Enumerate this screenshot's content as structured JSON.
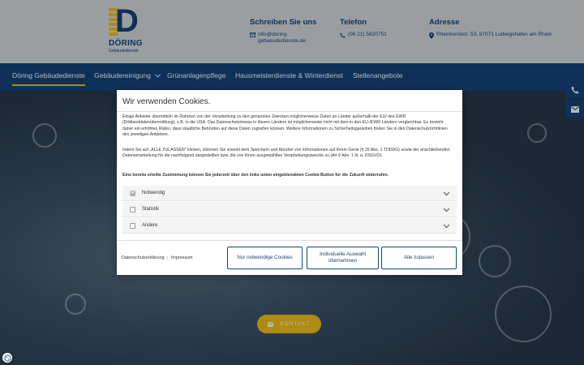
{
  "brand": {
    "name": "DÖRING",
    "tagline": "Gebäudedienste",
    "logo_letter": "D",
    "primary_color": "#15437c",
    "accent_color": "#f2c21b"
  },
  "contact": {
    "write": {
      "heading": "Schreiben Sie uns",
      "value": "info@doring-gebaeudedienste.de",
      "icon": "envelope-icon"
    },
    "phone": {
      "heading": "Telefon",
      "value": "(06 21) 5820751",
      "icon": "phone-icon"
    },
    "address": {
      "heading": "Adresse",
      "value": "Rheinhorststr. 53, 67071 Ludwigshafen am Rhein",
      "icon": "location-pin-icon"
    }
  },
  "nav": {
    "items": [
      {
        "label": "Döring Gebäudedienste",
        "active": true
      },
      {
        "label": "Gebäudereinigung",
        "has_dropdown": true
      },
      {
        "label": "Grünanlagenpflege"
      },
      {
        "label": "Hausmeisterdienste & Winterdienst"
      },
      {
        "label": "Stellenangebote"
      }
    ]
  },
  "hero": {
    "cta_label": "KONTAKT",
    "cta_icon": "envelope-icon"
  },
  "side_buttons": [
    "phone-icon",
    "envelope-icon"
  ],
  "cookie": {
    "title": "Wir verwenden Cookies.",
    "paragraph1": "Einige Anbieter übermitteln im Rahmen von der Verarbeitung zu den genannten Zwecken möglicherweise Daten an Länder außerhalb der EU/ des EWR (Drittlanddatenübermittlung), z.B. in die USA. Das Datenschutzniveau in diesen Ländern ist möglicherweise nicht mit dem in den EU-/EWR-Ländern vergleichbar. Es besteht daher ein erhöhtes Risiko, dass staatliche Behörden auf diese Daten zugreifen können. Weitere Informationen zu Sicherheitsgarantien finden Sie in den Datenschutzrichtlinien des jeweiligen Anbieters.",
    "paragraph2": "Indem Sie auf „ALLE ZULASSEN\" klicken, stimmen Sie sowohl dem Speichern und Abrufen von Informationen auf Ihrem Gerät (§ 25 Abs. 1 TDDDG) sowie der anschließenden Datenverarbeitung für die nachfolgend dargestellten bzw. die von Ihnen ausgewählten Verarbeitungszwecke zu (Art 6 Abs. 1 lit. a. DSGVO).",
    "paragraph3": "Eine bereits erteilte Zustimmung können Sie jederzeit über den links unten eingeblendeten Cookie-Button für die Zukunft widerrufen.",
    "categories": [
      {
        "label": "Notwendig",
        "checked": true,
        "disabled": true
      },
      {
        "label": "Statistik",
        "checked": false
      },
      {
        "label": "Andere",
        "checked": false
      }
    ],
    "links": {
      "privacy": "Datenschutzerklärung",
      "separator": "|",
      "imprint": "Impressum"
    },
    "buttons": {
      "necessary": "Nur notwendige Cookies",
      "individual": "Individuelle Auswahl übernehmen",
      "all": "Alle zulassen"
    }
  }
}
